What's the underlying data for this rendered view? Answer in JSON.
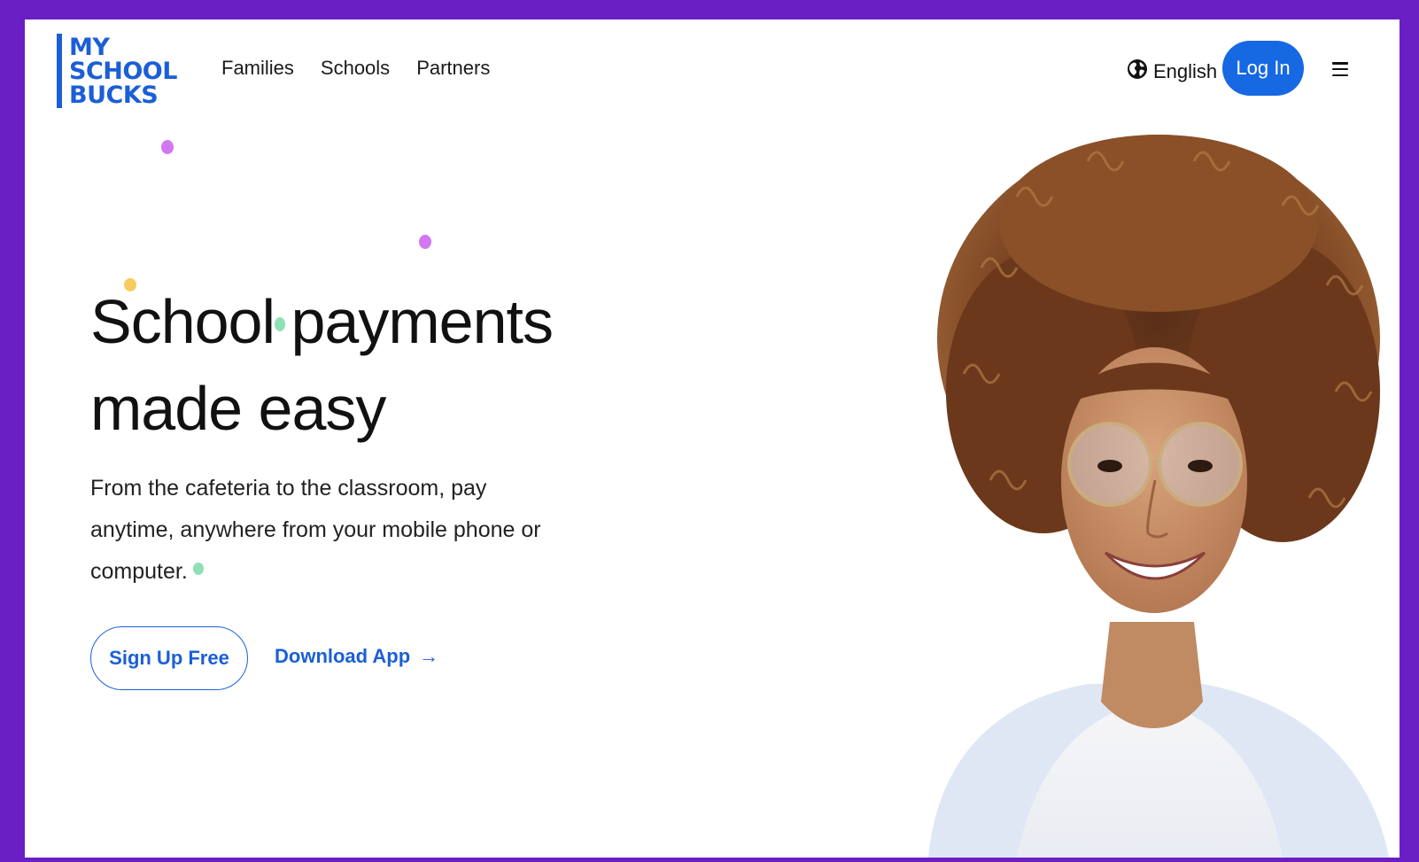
{
  "brand": {
    "logo_lines": [
      "MY",
      "SCHOOL",
      "BUCKS"
    ]
  },
  "nav": {
    "items": [
      "Families",
      "Schools",
      "Partners"
    ]
  },
  "header": {
    "language_label": "English",
    "login_label": "Log In"
  },
  "hero": {
    "title_line1": "School payments",
    "title_line2": "made easy",
    "subtitle": "From the cafeteria to the classroom, pay anytime, anywhere from your mobile phone or computer.",
    "signup_label": "Sign Up Free",
    "download_label": "Download App",
    "download_arrow": "→"
  },
  "colors": {
    "frame": "#6a1fc4",
    "brand_blue": "#1b5fd6",
    "button_blue": "#1668e3",
    "dot_purple": "#d277f2",
    "dot_yellow": "#f6cc5e",
    "dot_green": "#8fe0b4"
  },
  "icons": {
    "language": "globe-icon",
    "dropdown": "caret-down-icon",
    "menu": "hamburger-menu-icon",
    "download_arrow": "arrow-right-icon"
  }
}
